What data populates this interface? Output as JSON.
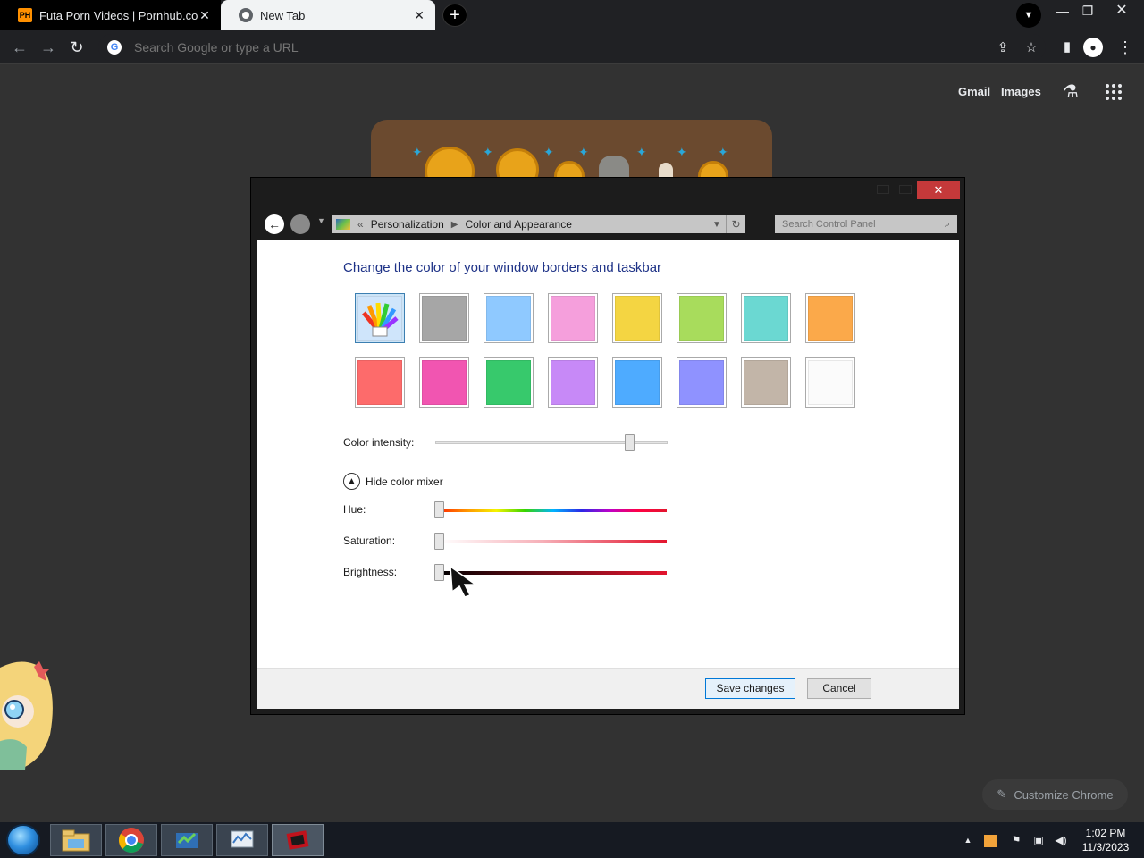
{
  "browser": {
    "tabs": [
      {
        "title": "Futa Porn Videos | Pornhub.com",
        "favicon": "PH",
        "active": false
      },
      {
        "title": "New Tab",
        "favicon": "chrome-icon",
        "active": true
      }
    ],
    "newtab_label": "+",
    "omnibox": {
      "placeholder": "Search Google or type a URL",
      "value": ""
    }
  },
  "ntp": {
    "gmail": "Gmail",
    "images": "Images",
    "customize": "Customize Chrome"
  },
  "control_panel": {
    "breadcrumb": [
      "Personalization",
      "Color and Appearance"
    ],
    "search_placeholder": "Search Control Panel",
    "heading": "Change the color of your window borders and taskbar",
    "swatches_row1": [
      "#color-wheel",
      "#a6a6a6",
      "#8fc9ff",
      "#f59fdc",
      "#f4d542",
      "#a8dc5c",
      "#6bd8d2",
      "#fba94a"
    ],
    "swatches_row2": [
      "#fd6b6b",
      "#f155b1",
      "#37c96c",
      "#c789f7",
      "#4eabff",
      "#8f92ff",
      "#c2b5a8",
      "#fbfbfb"
    ],
    "selected_swatch": 0,
    "intensity_label": "Color intensity:",
    "intensity_value": 0.85,
    "mixer_toggle": "Hide color mixer",
    "hue_label": "Hue:",
    "hue_value": 0,
    "saturation_label": "Saturation:",
    "saturation_value": 0,
    "brightness_label": "Brightness:",
    "brightness_value": 0,
    "save_label": "Save changes",
    "cancel_label": "Cancel"
  },
  "taskbar": {
    "apps": [
      "explorer-icon",
      "chrome-icon",
      "control-panel-icon",
      "resource-monitor-icon",
      "media-icon"
    ],
    "time": "1:02 PM",
    "date": "11/3/2023"
  }
}
